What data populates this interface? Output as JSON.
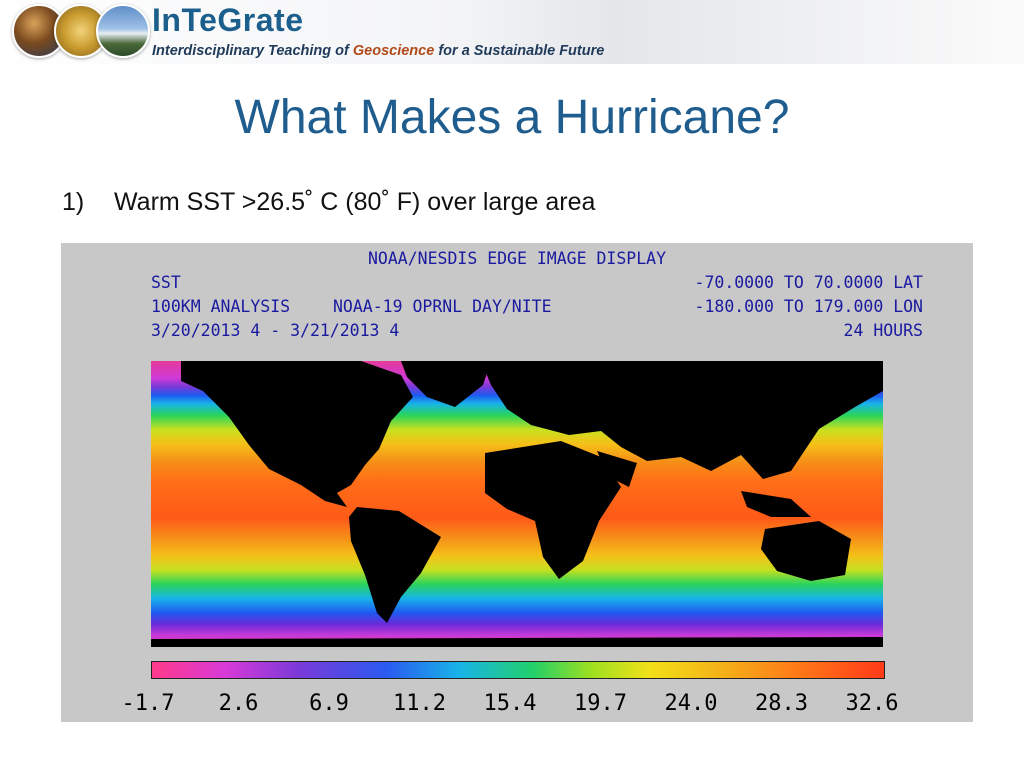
{
  "header": {
    "brand": "InTeGrate",
    "tagline_part1": "Interdisciplinary Teaching of ",
    "tagline_part2": "Geoscience",
    "tagline_part3": " for a Sustainable Future"
  },
  "slide": {
    "title": "What Makes a Hurricane?",
    "bullet_number": "1)",
    "bullet_text": "Warm SST >26.5˚ C (80˚ F) over large area"
  },
  "figure": {
    "header_center": "NOAA/NESDIS EDGE IMAGE DISPLAY",
    "left_line1": "SST",
    "left_line2": "100KM ANALYSIS",
    "left_line3": "3/20/2013 4 - 3/21/2013 4",
    "mid_line": "NOAA-19 OPRNL DAY/NITE",
    "right_line1": "-70.0000 TO 70.0000 LAT",
    "right_line2": "-180.000 TO 179.000 LON",
    "right_line3": "24 HOURS",
    "colorbar_ticks": [
      "-1.7",
      "2.6",
      "6.9",
      "11.2",
      "15.4",
      "19.7",
      "24.0",
      "28.3",
      "32.6"
    ],
    "land_color": "#000000",
    "warm_color": "#ff5a18",
    "cold_color": "#e43a9a"
  }
}
